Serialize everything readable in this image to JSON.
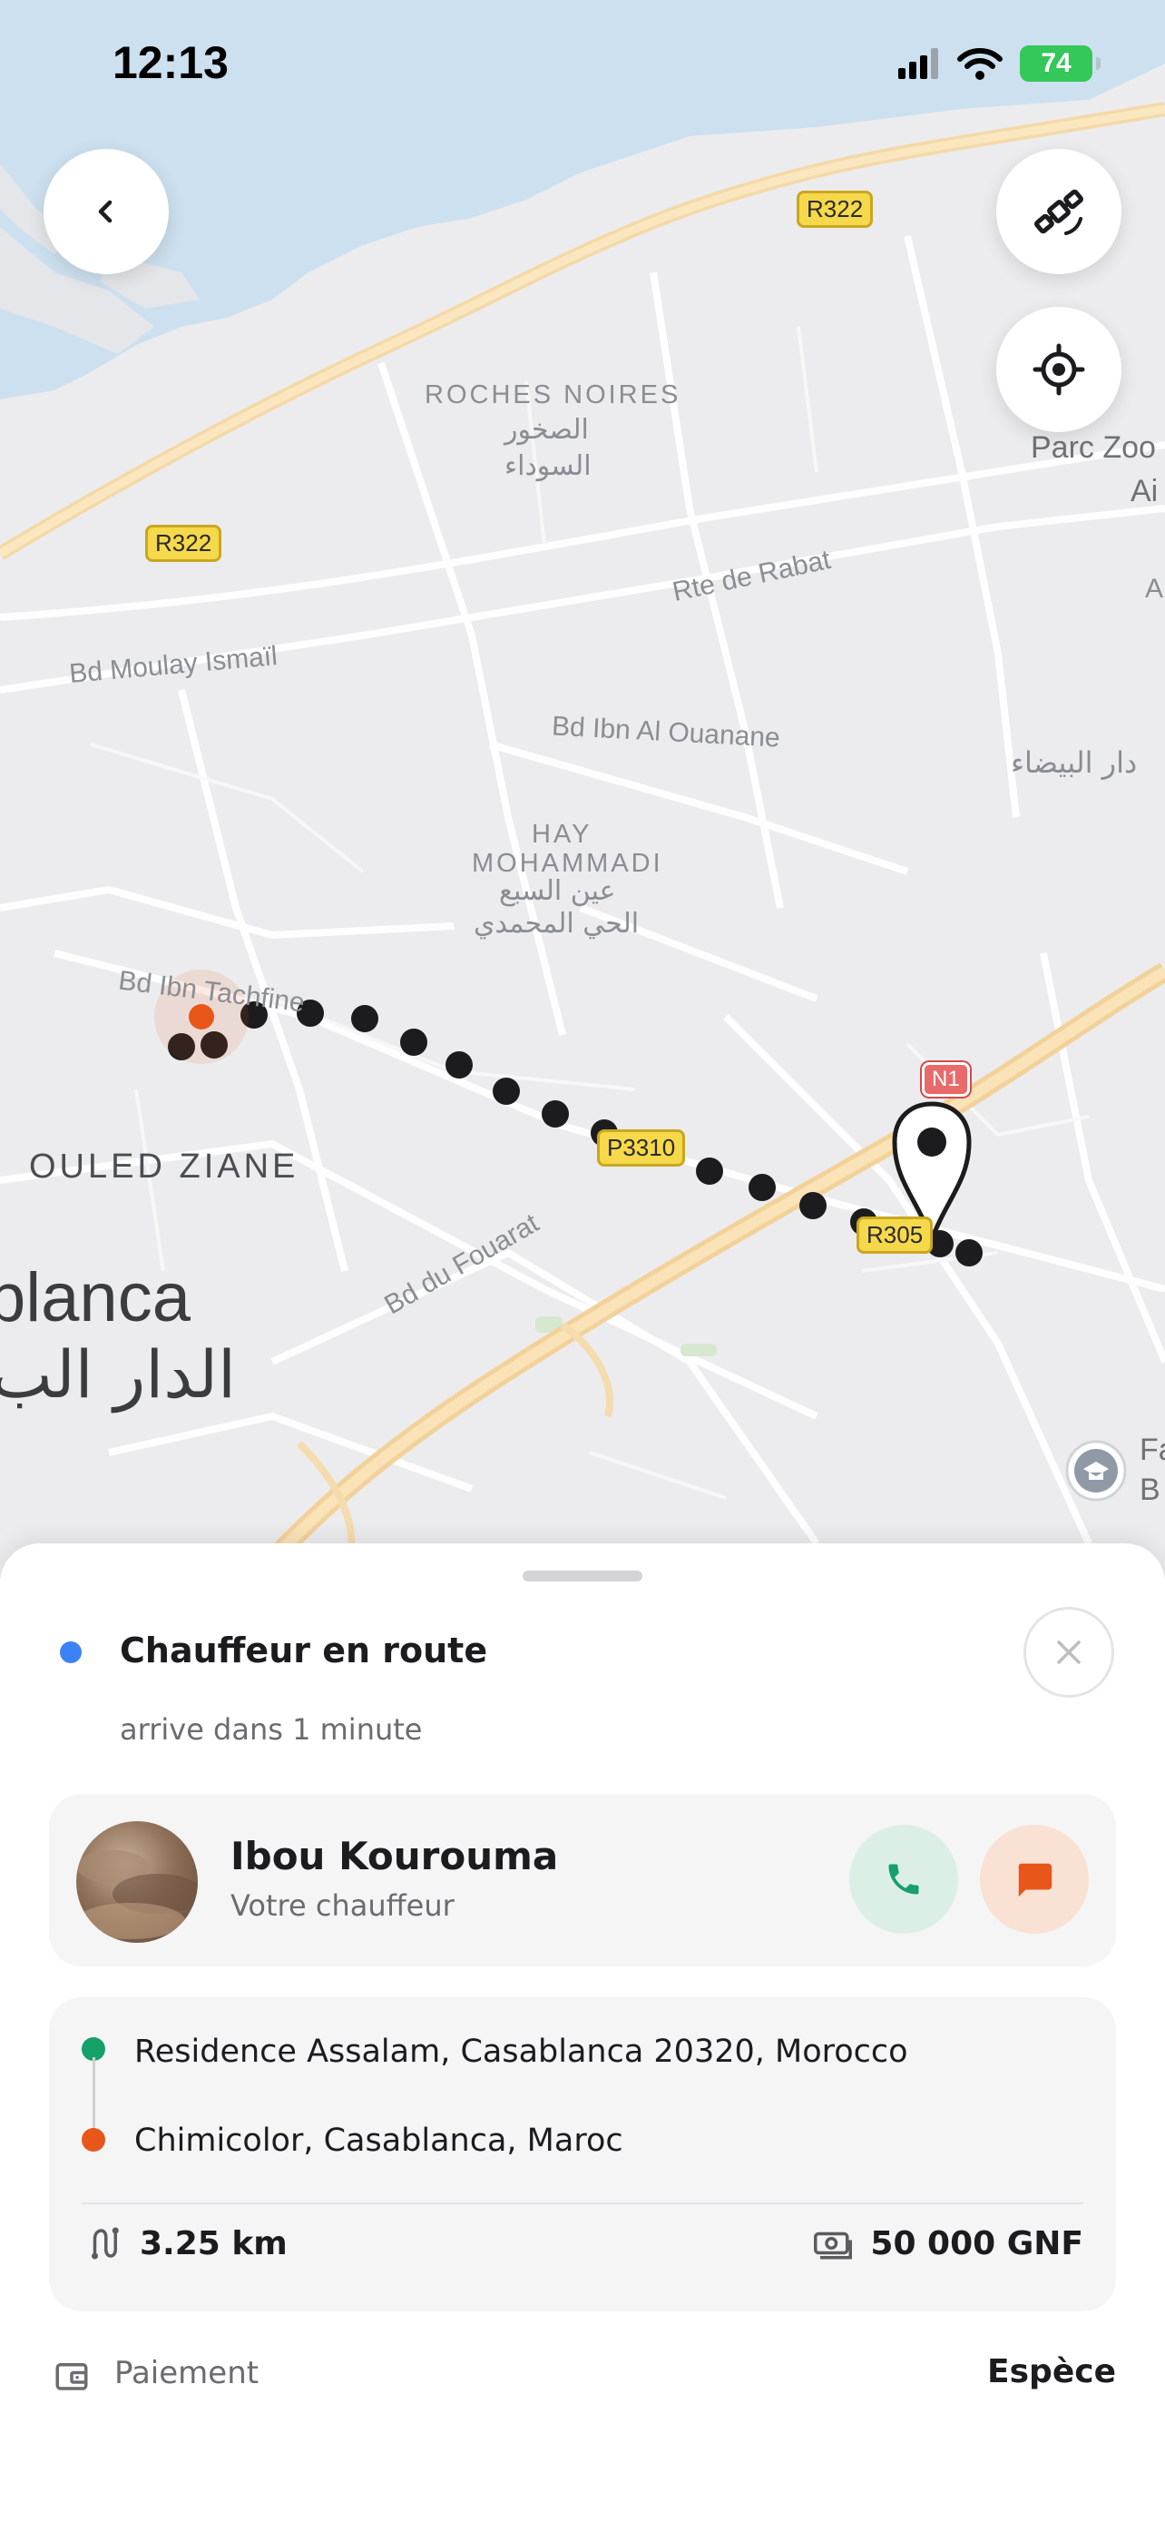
{
  "status_bar": {
    "time": "12:13",
    "battery": "74"
  },
  "map": {
    "roads": [
      "Bd Moulay Ismaïl",
      "Rte de Rabat",
      "Bd Ibn Al Ouanane",
      "Bd Ibn Tachfine",
      "Bd du Fouarat"
    ],
    "shields": [
      "R322",
      "R322",
      "N1",
      "P3310",
      "R305"
    ],
    "districts": {
      "roches_noires": "ROCHES NOIRES",
      "roches_noires_ar_1": "الصخور",
      "roches_noires_ar_2": "السوداء",
      "hay_mohammadi_1": "HAY",
      "hay_mohammadi_2": "MOHAMMADI",
      "hay_mohammadi_ar_1": "عين السبع",
      "hay_mohammadi_ar_2": "الحي المحمدي",
      "ouled_ziane": "OULED ZIANE",
      "parc_1": "Parc Zoo",
      "parc_2": "Ai",
      "right_ar": "دار البيضاء",
      "right_a": "A",
      "right_edge_1": "Fa",
      "right_edge_2": "B"
    },
    "city": {
      "latin": "blanca",
      "arabic": "الدار الب"
    },
    "icons": [
      "back-chevron-icon",
      "satellite-icon",
      "locate-icon",
      "pin-icon",
      "school-icon"
    ]
  },
  "sheet": {
    "status_title": "Chauffeur en route",
    "status_subtitle": "arrive dans 1 minute",
    "driver": {
      "name": "Ibou Kourouma",
      "role": "Votre chauffeur"
    },
    "route": {
      "pickup": "Residence Assalam, Casablanca 20320, Morocco",
      "dropoff": "Chimicolor, Casablanca, Maroc",
      "distance": "3.25 km",
      "price": "50 000 GNF"
    },
    "payment": {
      "label": "Paiement",
      "value": "Espèce"
    }
  },
  "colors": {
    "accent_blue": "#3b82f6",
    "pickup_green": "#16a06a",
    "dropoff_orange": "#e8561a",
    "call_bg": "#dcefe6",
    "chat_bg": "#f9e1d4"
  }
}
